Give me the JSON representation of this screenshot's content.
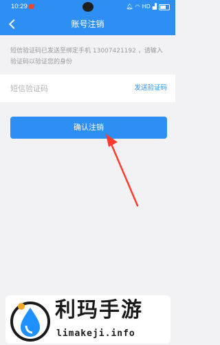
{
  "status_bar": {
    "time": "10:29",
    "right_icons": [
      "bell-icon",
      "wifi-icon",
      "network-icon",
      "signal-icon",
      "battery-icon"
    ],
    "network_label": "HD"
  },
  "nav": {
    "title": "账号注销"
  },
  "notice": {
    "text": "短信验证码已发送至绑定手机 13007421192 ，请输入验证码以验证您的身份"
  },
  "code_row": {
    "placeholder": "短信验证码",
    "value": "",
    "send_label": "发送验证码"
  },
  "confirm": {
    "label": "确认注销"
  },
  "watermark": {
    "title": "利玛手游",
    "url": "limakeji.info"
  },
  "colors": {
    "primary": "#2d8ff3",
    "background": "#f2f2f4",
    "annotation_arrow": "#ff3b30"
  }
}
